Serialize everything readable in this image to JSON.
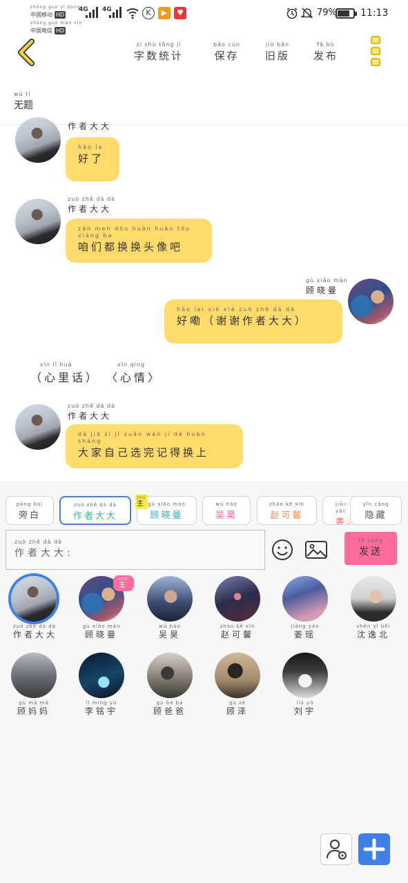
{
  "status": {
    "carrier1": "中国移动",
    "carrier1_py": "zhōng guó yí dòng",
    "carrier2": "中国电信",
    "carrier2_py": "zhōng guó diàn xìn",
    "hd": "HD",
    "net1": "4G",
    "net2": "4G",
    "battery": "79%",
    "battery_level": 0.79,
    "time": "11:13"
  },
  "header": {
    "menu": [
      {
        "label": "字数统计",
        "py": "zì shù tǒng jì"
      },
      {
        "label": "保存",
        "py": "bǎo cún"
      },
      {
        "label": "旧版",
        "py": "jiù bǎn"
      },
      {
        "label": "发布",
        "py": "fā bù"
      }
    ]
  },
  "doc": {
    "title": "无题",
    "title_py": "wú tí"
  },
  "chat": {
    "messages": [
      {
        "sender": "作者大大",
        "sender_py": "zuò zhě dà dà",
        "text": "好了",
        "text_py": "hǎo le"
      },
      {
        "sender": "作者大大",
        "sender_py": "zuò zhě dà dà",
        "text": "咱们都换换头像吧",
        "text_py": "zán men dōu huàn huàn tóu xiàng ba"
      },
      {
        "sender": "顾晓曼",
        "sender_py": "gù xiǎo màn",
        "text": "好嘞（谢谢作者大大）",
        "text_py": "hǎo lei   xiè xiè zuò zhě dà dà"
      },
      {
        "sender": "作者大大",
        "sender_py": "zuò zhě dà dà",
        "text": "大家自己选完记得换上",
        "text_py": "dà jiā zì jǐ xuǎn wán jì dé huàn shàng"
      }
    ],
    "inner_voice": "（心里话）",
    "inner_voice_py": "xīn lǐ huà",
    "mood": "〈心情〉",
    "mood_py": "xīn qíng"
  },
  "panel": {
    "chips": [
      {
        "label": "旁白",
        "py": "páng bái",
        "color": "#555555"
      },
      {
        "label": "作者大大",
        "py": "zuò zhě dà dà",
        "color": "#2fb3a8"
      },
      {
        "label": "顾晓曼",
        "py": "gù xiǎo màn",
        "color": "#2fb3a8"
      },
      {
        "label": "吴昊",
        "py": "wú hào",
        "color": "#ff5c9a"
      },
      {
        "label": "赵可馨",
        "py": "zhào kě xīn",
        "color": "#ff8a5c"
      },
      {
        "label": "姜瑶",
        "py": "jiāng yáo",
        "color": "#ff5c5c"
      },
      {
        "label": "隐藏",
        "py": "yǐn cáng",
        "color": "#555555"
      }
    ],
    "main_badge": "主",
    "main_badge_py": "zhǔ",
    "input_placeholder": "作者大大:",
    "input_placeholder_py": "zuò zhě dà dà",
    "send_label": "发送",
    "send_py": "fā sòng",
    "members": [
      {
        "name": "作者大大",
        "py": "zuò zhě dà dà"
      },
      {
        "name": "顾晓曼",
        "py": "gù xiǎo màn"
      },
      {
        "name": "吴昊",
        "py": "wú hào"
      },
      {
        "name": "赵可馨",
        "py": "zhào kě xīn"
      },
      {
        "name": "姜瑶",
        "py": "jiāng yáo"
      },
      {
        "name": "沈逸北",
        "py": "shěn yì běi"
      },
      {
        "name": "顾妈妈",
        "py": "gù mā mā"
      },
      {
        "name": "李铭宇",
        "py": "lǐ míng yǔ"
      },
      {
        "name": "顾爸爸",
        "py": "gù bà bà"
      },
      {
        "name": "顾泽",
        "py": "gù zé"
      },
      {
        "name": "刘宇",
        "py": "liú yǔ"
      }
    ]
  },
  "colors": {
    "bubble": "#fedb6a",
    "accent_pink": "#ff6b9c",
    "accent_blue": "#3f7fe6",
    "back_yellow": "#f2d23c"
  }
}
